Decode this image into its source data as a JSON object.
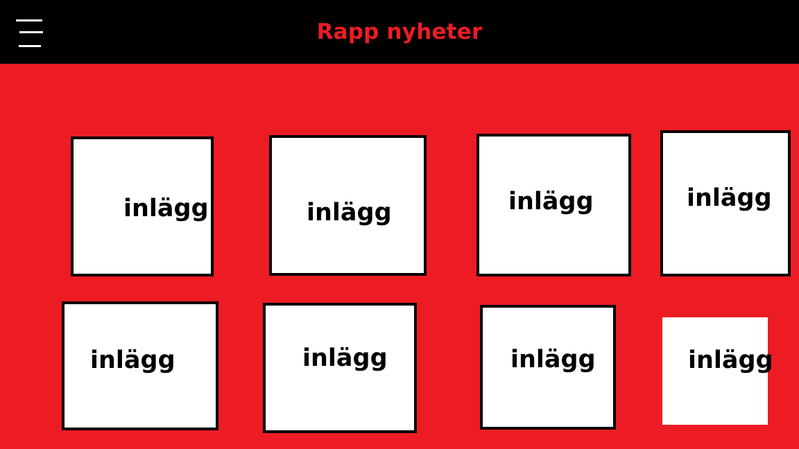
{
  "header": {
    "title": "Rapp nyheter",
    "menu_icon": "hamburger-menu-icon"
  },
  "colors": {
    "background": "#ed1c24",
    "header_bg": "#000000",
    "title": "#ed1c24",
    "card_bg": "#ffffff",
    "card_border": "#000000"
  },
  "posts": [
    {
      "label": "inlägg"
    },
    {
      "label": "inlägg"
    },
    {
      "label": "inlägg"
    },
    {
      "label": "inlägg"
    },
    {
      "label": "inlägg"
    },
    {
      "label": "inlägg"
    },
    {
      "label": "inlägg"
    },
    {
      "label": "inlägg"
    }
  ]
}
